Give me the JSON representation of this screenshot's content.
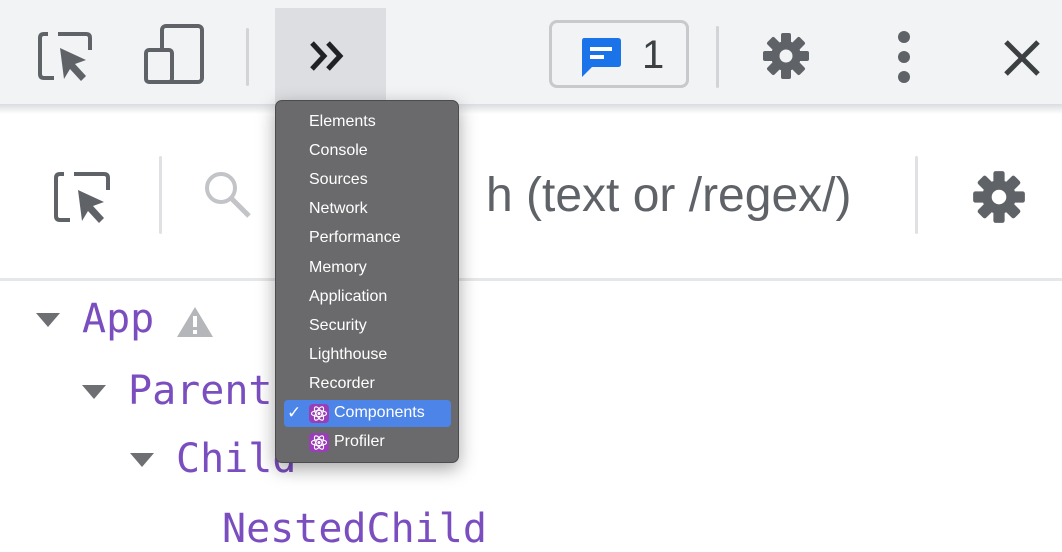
{
  "toolbar": {
    "icons": {
      "inspect": "inspect-element-icon",
      "device": "device-toolbar-icon",
      "more_tabs": "double-chevron-right-icon",
      "issues": "issues-message-icon",
      "settings": "gear-icon",
      "menu": "vertical-ellipsis-icon",
      "close": "close-icon"
    },
    "issues_count": "1"
  },
  "panel": {
    "search_placeholder": "Search (text or /regex/)",
    "search_visible_text": "h (text or /regex/)",
    "icons": {
      "select": "select-component-icon",
      "search": "search-icon",
      "settings": "gear-icon"
    }
  },
  "tree": [
    {
      "name": "App",
      "depth": 0,
      "expanded": true,
      "warning": true
    },
    {
      "name": "Parent",
      "depth": 1,
      "expanded": true
    },
    {
      "name": "Child",
      "depth": 2,
      "expanded": true
    },
    {
      "name": "NestedChild",
      "depth": 3,
      "expanded": false
    }
  ],
  "menu": {
    "items": [
      {
        "label": "Elements"
      },
      {
        "label": "Console"
      },
      {
        "label": "Sources"
      },
      {
        "label": "Network"
      },
      {
        "label": "Performance"
      },
      {
        "label": "Memory"
      },
      {
        "label": "Application"
      },
      {
        "label": "Security"
      },
      {
        "label": "Lighthouse"
      },
      {
        "label": "Recorder"
      },
      {
        "label": "Components",
        "icon": "react-icon",
        "selected": true,
        "check": "✓"
      },
      {
        "label": "Profiler",
        "icon": "react-icon"
      }
    ]
  },
  "colors": {
    "component_name": "#7b4ec0",
    "menu_background": "#6a6a6c",
    "menu_selected": "#4d84e8",
    "issues_icon": "#1a73e8",
    "react_badge": "#9b3db8"
  }
}
